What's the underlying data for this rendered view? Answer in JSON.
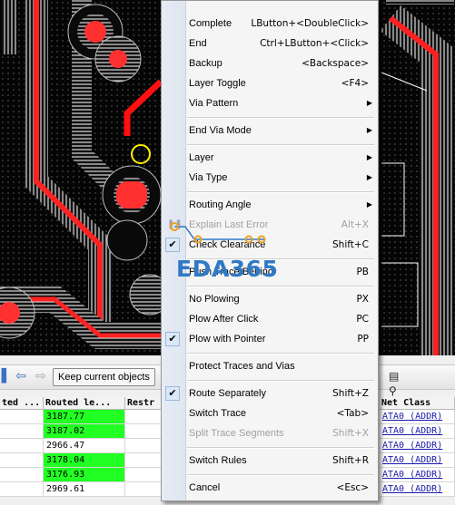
{
  "toolbar": {
    "keep_label": "Keep current objects"
  },
  "grid": {
    "headers": [
      "ted ...",
      "Routed le...",
      "Restr",
      "Net Class"
    ],
    "rows": [
      {
        "routed": "3187.77",
        "highlight": true,
        "net": "ATA0 (ADDR)"
      },
      {
        "routed": "3187.02",
        "highlight": true,
        "net": "ATA0 (ADDR)"
      },
      {
        "routed": "2966.47",
        "highlight": false,
        "net": "ATA0 (ADDR)"
      },
      {
        "routed": "3178.04",
        "highlight": true,
        "net": "ATA0 (ADDR)"
      },
      {
        "routed": "3176.93",
        "highlight": true,
        "net": "ATA0 (ADDR)"
      },
      {
        "routed": "2969.61",
        "highlight": false,
        "net": "ATA0 (ADDR)"
      }
    ]
  },
  "menu": {
    "items": [
      {
        "label": "Complete",
        "accel": "LButton+<DoubleClick>"
      },
      {
        "label": "End",
        "accel": "Ctrl+LButton+<Click>"
      },
      {
        "label": "Backup",
        "accel": "<Backspace>"
      },
      {
        "label": "Layer Toggle",
        "accel": "<F4>"
      },
      {
        "label": "Via Pattern",
        "submenu": true
      },
      {
        "label": "End Via Mode",
        "submenu": true
      },
      {
        "label": "Layer",
        "submenu": true
      },
      {
        "label": "Via Type",
        "submenu": true
      },
      {
        "label": "Routing Angle",
        "submenu": true
      },
      {
        "label": "Explain Last Error",
        "accel": "Alt+X",
        "disabled": true
      },
      {
        "label": "Check Clearance",
        "accel": "Shift+C",
        "checked": true
      },
      {
        "label": "Push Trace Behind",
        "accel": "PB"
      },
      {
        "label": "No Plowing",
        "accel": "PX"
      },
      {
        "label": "Plow After Click",
        "accel": "PC"
      },
      {
        "label": "Plow with Pointer",
        "accel": "PP",
        "checked": true
      },
      {
        "label": "Protect Traces and Vias"
      },
      {
        "label": "Route Separately",
        "accel": "Shift+Z",
        "checked": true
      },
      {
        "label": "Switch Trace",
        "accel": "<Tab>"
      },
      {
        "label": "Split Trace Segments",
        "accel": "Shift+X",
        "disabled": true
      },
      {
        "label": "Switch Rules",
        "accel": "Shift+R"
      },
      {
        "label": "Cancel",
        "accel": "<Esc>"
      }
    ]
  },
  "watermark": {
    "text": "EDA365"
  },
  "colors": {
    "trace": "#ff2020",
    "highlight": "#22ff22",
    "accent": "#2f79c6"
  },
  "icons": [
    "left-arrow-icon",
    "right-arrow-icon",
    "find-replace-icon",
    "checkmark-icon",
    "submenu-arrow-icon",
    "pause-icon"
  ]
}
